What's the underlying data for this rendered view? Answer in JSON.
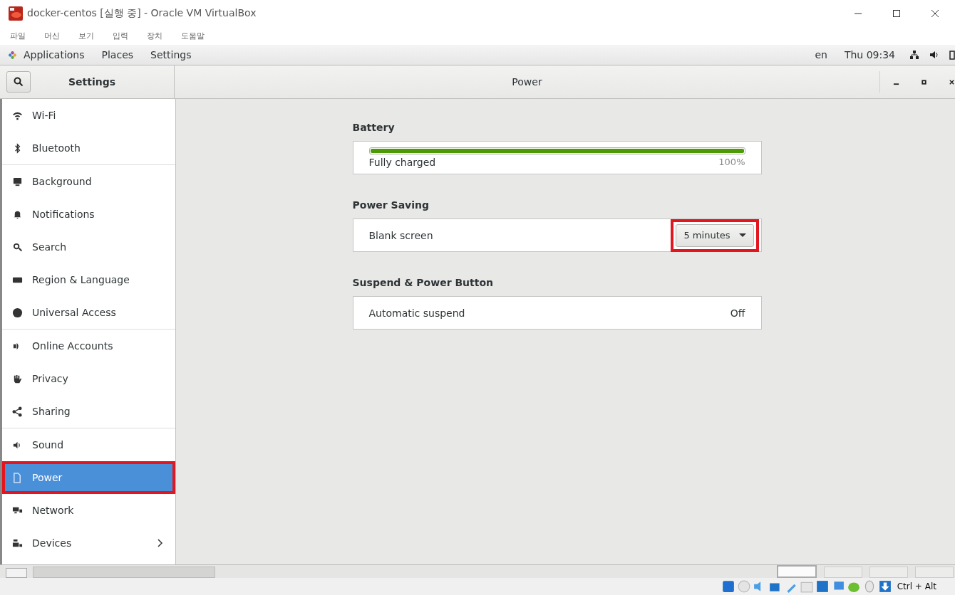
{
  "window": {
    "title": "docker-centos [실행 중] - Oracle VM VirtualBox"
  },
  "menu": [
    "파일",
    "머신",
    "보기",
    "입력",
    "장치",
    "도움말"
  ],
  "top_bar": {
    "items": [
      "Applications",
      "Places",
      "Settings"
    ],
    "language": "en",
    "clock": "Thu 09:34"
  },
  "header": {
    "sidebar_title": "Settings",
    "page_title": "Power"
  },
  "sidebar": {
    "groups": [
      [
        {
          "label": "Wi-Fi",
          "selected": false,
          "highlighted": false
        },
        {
          "label": "Bluetooth",
          "selected": false,
          "highlighted": false
        }
      ],
      [
        {
          "label": "Background",
          "selected": false,
          "highlighted": false
        },
        {
          "label": "Notifications",
          "selected": false,
          "highlighted": false
        },
        {
          "label": "Search",
          "selected": false,
          "highlighted": false
        },
        {
          "label": "Region & Language",
          "selected": false,
          "highlighted": false
        },
        {
          "label": "Universal Access",
          "selected": false,
          "highlighted": false
        }
      ],
      [
        {
          "label": "Online Accounts",
          "selected": false,
          "highlighted": false
        },
        {
          "label": "Privacy",
          "selected": false,
          "highlighted": false
        },
        {
          "label": "Sharing",
          "selected": false,
          "highlighted": false
        }
      ],
      [
        {
          "label": "Sound",
          "selected": false,
          "highlighted": false
        },
        {
          "label": "Power",
          "selected": true,
          "highlighted": true
        },
        {
          "label": "Network",
          "selected": false,
          "highlighted": false
        },
        {
          "label": "Devices",
          "selected": false,
          "highlighted": false,
          "submenu": true
        }
      ]
    ]
  },
  "sections": [
    {
      "title": "Battery",
      "rows": [
        {
          "kind": "meter",
          "label": "Fully charged",
          "value": "100%",
          "level": 1
        }
      ]
    },
    {
      "title": "Power Saving",
      "rows": [
        {
          "kind": "dropdown",
          "label": "Blank screen",
          "value": "5 minutes",
          "highlighted": true
        }
      ]
    },
    {
      "title": "Suspend & Power Button",
      "rows": [
        {
          "kind": "text",
          "label": "Automatic suspend",
          "value": "Off"
        }
      ]
    }
  ],
  "workspaces": [
    {
      "selected": true
    },
    {
      "selected": false
    },
    {
      "selected": false
    },
    {
      "selected": false
    }
  ],
  "status_bar": {
    "host_key": "Ctrl + Alt"
  }
}
